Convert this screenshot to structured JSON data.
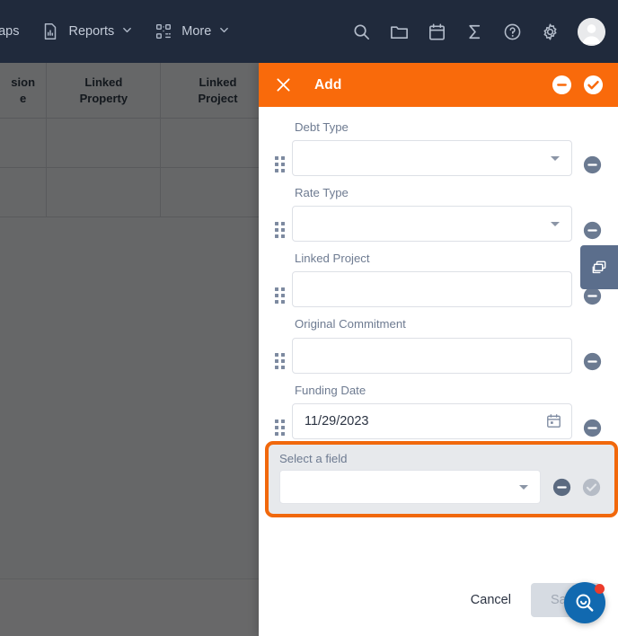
{
  "topnav": {
    "items": [
      {
        "label": "Maps",
        "icon": "map-icon",
        "has_caret": false,
        "truncated": true
      },
      {
        "label": "Reports",
        "icon": "report-chart-icon",
        "has_caret": true,
        "truncated": false
      },
      {
        "label": "More",
        "icon": "qr-grid-icon",
        "has_caret": true,
        "truncated": false
      }
    ],
    "actions": [
      {
        "name": "search-icon"
      },
      {
        "name": "folder-icon"
      },
      {
        "name": "calendar-icon"
      },
      {
        "name": "sigma-icon"
      },
      {
        "name": "help-icon"
      },
      {
        "name": "gear-icon"
      }
    ],
    "avatar": "user-avatar",
    "bg_color": "#202A3C"
  },
  "background_table": {
    "headers": [
      "sion\ne",
      "Linked\nProperty",
      "Linked\nProject"
    ],
    "header_cells": [
      {
        "line1": "sion",
        "line2": "e"
      },
      {
        "line1": "Linked",
        "line2": "Property"
      },
      {
        "line1": "Linked",
        "line2": "Project"
      }
    ],
    "rows": [
      [
        "",
        "",
        ""
      ],
      [
        "",
        "",
        ""
      ]
    ]
  },
  "panel": {
    "header": {
      "title": "Add",
      "close_icon": "close-icon",
      "remove_icon": "remove-circle-icon",
      "confirm_icon": "check-circle-icon",
      "bg_color": "#F96A0B"
    },
    "fields": [
      {
        "label": "Debt Type",
        "value": "",
        "placeholder": "",
        "type": "select",
        "has_remove": true,
        "drag_handle": "drag-handle-icon"
      },
      {
        "label": "Rate Type",
        "value": "",
        "placeholder": "",
        "type": "select",
        "has_remove": true,
        "drag_handle": "drag-handle-icon"
      },
      {
        "label": "Linked Project",
        "value": "",
        "placeholder": "",
        "type": "text",
        "has_remove": true,
        "drag_handle": "drag-handle-icon"
      },
      {
        "label": "Original Commitment",
        "value": "",
        "placeholder": "",
        "type": "text",
        "has_remove": true,
        "drag_handle": "drag-handle-icon"
      },
      {
        "label": "Funding Date",
        "value": "11/29/2023",
        "placeholder": "",
        "type": "date",
        "has_remove": true,
        "drag_handle": "drag-handle-icon"
      }
    ],
    "duplicate_tooltip": {
      "icon": "duplicate-layers-icon",
      "bg_color": "#5B6E8C"
    },
    "highlighted_field": {
      "label": "Select a field",
      "value": "",
      "type": "select",
      "border_color": "#F1680C",
      "bg_color": "#E7E9EC",
      "remove_icon": "remove-circle-icon",
      "confirm_icon": "check-circle-icon-disabled"
    },
    "footer": {
      "cancel_label": "Cancel",
      "save_label": "Save",
      "save_disabled": true
    }
  },
  "fab": {
    "icon": "search-smile-icon",
    "has_badge": true,
    "bg_color": "#1169B0",
    "badge_color": "#EC3B2B"
  }
}
